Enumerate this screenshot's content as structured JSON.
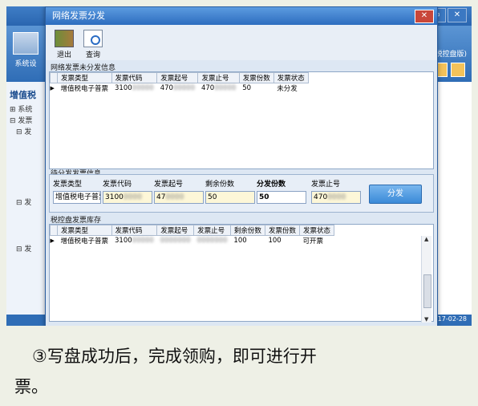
{
  "dialog": {
    "title": "网络发票分发",
    "close_glyph": "✕"
  },
  "toolbar": {
    "exit_label": "退出",
    "query_label": "查询"
  },
  "background": {
    "system_label": "系统设",
    "left_title": "增值税",
    "tree": [
      "⊞ 系统",
      "⊟ 发票",
      "⊟ 发",
      "⊟ 发",
      "⊟ 发"
    ],
    "taxdisk_label": "(税控盘版)",
    "date_text": "17-02-28",
    "window_controls": [
      "▭",
      "✕"
    ]
  },
  "undistributed": {
    "title": "网络发票未分发信息",
    "columns": [
      "发票类型",
      "发票代码",
      "发票起号",
      "发票止号",
      "发票份数",
      "发票状态"
    ],
    "rows": [
      {
        "type": "增值税电子普票",
        "code": "3100",
        "start": "470",
        "end": "470",
        "count": "50",
        "status": "未分发"
      }
    ]
  },
  "pending": {
    "title": "待分发发票信息",
    "labels": [
      "发票类型",
      "发票代码",
      "发票起号",
      "剩余份数",
      "分发份数",
      "发票止号"
    ],
    "values": {
      "type": "增值税电子普票",
      "code": "3100",
      "start": "47",
      "remaining": "50",
      "distribute": "50",
      "end": "470"
    },
    "button_label": "分发"
  },
  "inventory": {
    "title": "税控盘发票库存",
    "columns": [
      "发票类型",
      "发票代码",
      "发票起号",
      "发票止号",
      "剩余份数",
      "发票份数",
      "发票状态"
    ],
    "rows": [
      {
        "type": "增值税电子普票",
        "code": "3100",
        "start": "",
        "end": "",
        "remaining": "100",
        "count": "100",
        "status": "可开票"
      }
    ]
  },
  "caption": {
    "line1": "③写盘成功后，完成领购，即可进行开",
    "line2": "票。"
  }
}
